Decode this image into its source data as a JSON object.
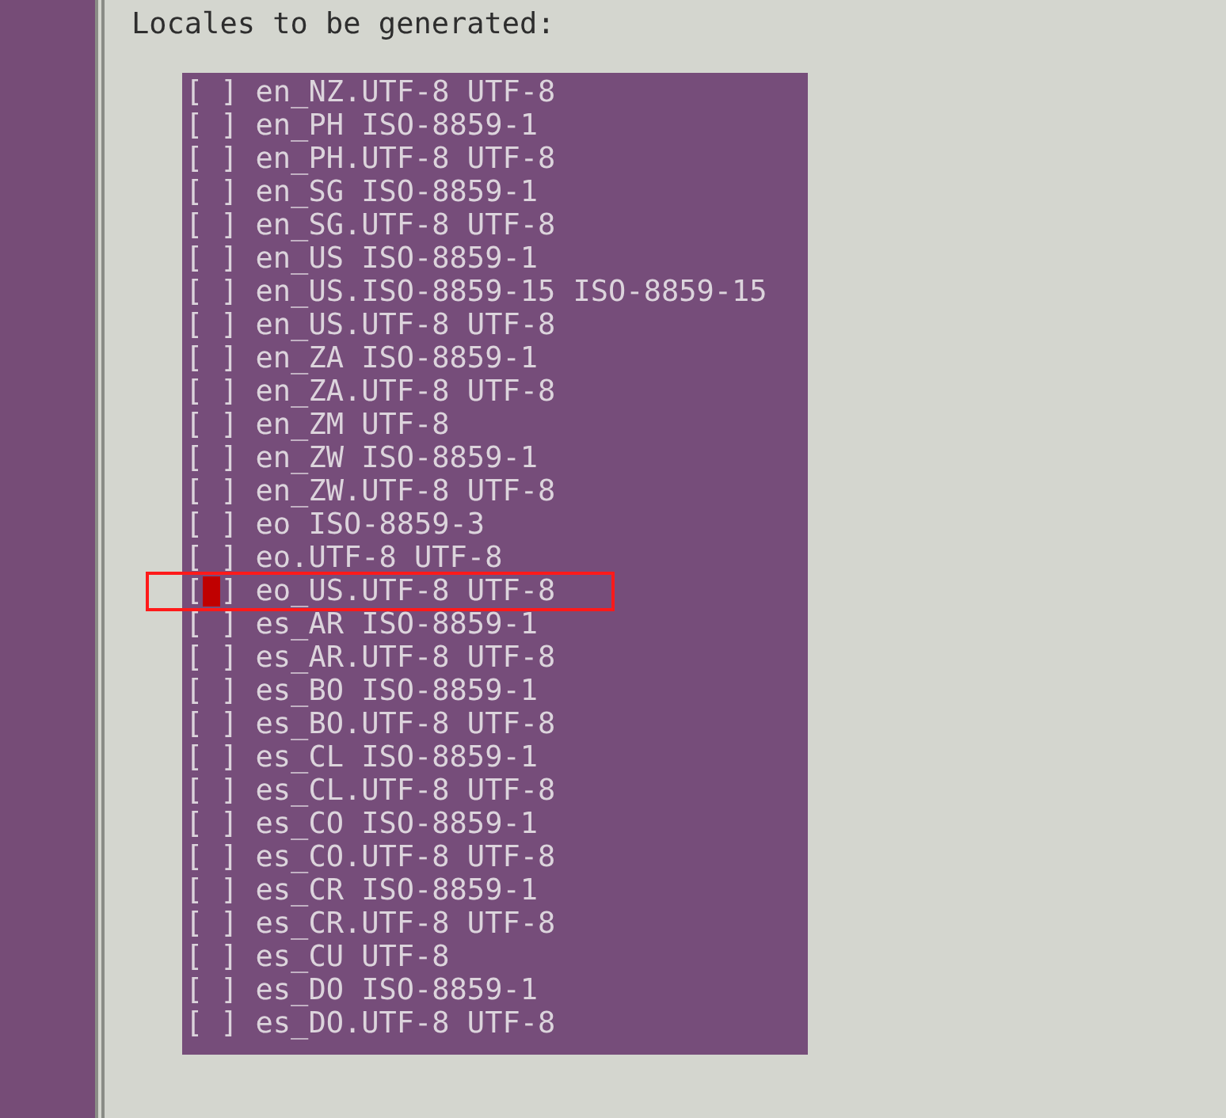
{
  "title": "Locales to be generated:",
  "checkbox": {
    "left": "[",
    "right": "]"
  },
  "items": [
    {
      "label": "en_NZ.UTF-8 UTF-8",
      "checked": false,
      "focused": false,
      "highlighted": false
    },
    {
      "label": "en_PH ISO-8859-1",
      "checked": false,
      "focused": false,
      "highlighted": false
    },
    {
      "label": "en_PH.UTF-8 UTF-8",
      "checked": false,
      "focused": false,
      "highlighted": false
    },
    {
      "label": "en_SG ISO-8859-1",
      "checked": false,
      "focused": false,
      "highlighted": false
    },
    {
      "label": "en_SG.UTF-8 UTF-8",
      "checked": false,
      "focused": false,
      "highlighted": false
    },
    {
      "label": "en_US ISO-8859-1",
      "checked": false,
      "focused": false,
      "highlighted": false
    },
    {
      "label": "en_US.ISO-8859-15 ISO-8859-15",
      "checked": false,
      "focused": false,
      "highlighted": false
    },
    {
      "label": "en_US.UTF-8 UTF-8",
      "checked": false,
      "focused": false,
      "highlighted": false
    },
    {
      "label": "en_ZA ISO-8859-1",
      "checked": false,
      "focused": false,
      "highlighted": false
    },
    {
      "label": "en_ZA.UTF-8 UTF-8",
      "checked": false,
      "focused": false,
      "highlighted": false
    },
    {
      "label": "en_ZM UTF-8",
      "checked": false,
      "focused": false,
      "highlighted": false
    },
    {
      "label": "en_ZW ISO-8859-1",
      "checked": false,
      "focused": false,
      "highlighted": false
    },
    {
      "label": "en_ZW.UTF-8 UTF-8",
      "checked": false,
      "focused": false,
      "highlighted": false
    },
    {
      "label": "eo ISO-8859-3",
      "checked": false,
      "focused": false,
      "highlighted": false
    },
    {
      "label": "eo.UTF-8 UTF-8",
      "checked": false,
      "focused": false,
      "highlighted": false
    },
    {
      "label": "eo_US.UTF-8 UTF-8",
      "checked": false,
      "focused": true,
      "highlighted": true
    },
    {
      "label": "es_AR ISO-8859-1",
      "checked": false,
      "focused": false,
      "highlighted": false
    },
    {
      "label": "es_AR.UTF-8 UTF-8",
      "checked": false,
      "focused": false,
      "highlighted": false
    },
    {
      "label": "es_BO ISO-8859-1",
      "checked": false,
      "focused": false,
      "highlighted": false
    },
    {
      "label": "es_BO.UTF-8 UTF-8",
      "checked": false,
      "focused": false,
      "highlighted": false
    },
    {
      "label": "es_CL ISO-8859-1",
      "checked": false,
      "focused": false,
      "highlighted": false
    },
    {
      "label": "es_CL.UTF-8 UTF-8",
      "checked": false,
      "focused": false,
      "highlighted": false
    },
    {
      "label": "es_CO ISO-8859-1",
      "checked": false,
      "focused": false,
      "highlighted": false
    },
    {
      "label": "es_CO.UTF-8 UTF-8",
      "checked": false,
      "focused": false,
      "highlighted": false
    },
    {
      "label": "es_CR ISO-8859-1",
      "checked": false,
      "focused": false,
      "highlighted": false
    },
    {
      "label": "es_CR.UTF-8 UTF-8",
      "checked": false,
      "focused": false,
      "highlighted": false
    },
    {
      "label": "es_CU UTF-8",
      "checked": false,
      "focused": false,
      "highlighted": false
    },
    {
      "label": "es_DO ISO-8859-1",
      "checked": false,
      "focused": false,
      "highlighted": false
    },
    {
      "label": "es_DO.UTF-8 UTF-8",
      "checked": false,
      "focused": false,
      "highlighted": false
    }
  ]
}
